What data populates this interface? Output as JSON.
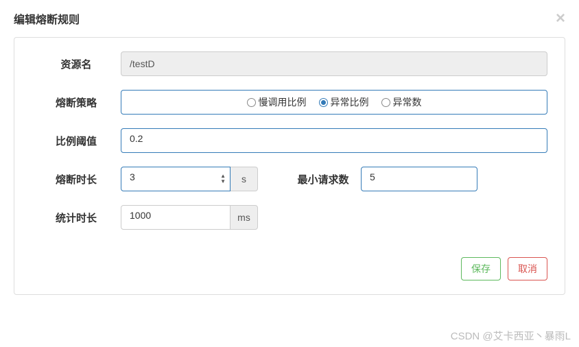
{
  "modal": {
    "title": "编辑熔断规则"
  },
  "form": {
    "resource": {
      "label": "资源名",
      "value": "/testD"
    },
    "strategy": {
      "label": "熔断策略",
      "options": [
        {
          "label": "慢调用比例",
          "checked": false
        },
        {
          "label": "异常比例",
          "checked": true
        },
        {
          "label": "异常数",
          "checked": false
        }
      ]
    },
    "threshold": {
      "label": "比例阈值",
      "value": "0.2"
    },
    "duration": {
      "label": "熔断时长",
      "value": "3",
      "unit": "s"
    },
    "minRequests": {
      "label": "最小请求数",
      "value": "5"
    },
    "statWindow": {
      "label": "统计时长",
      "value": "1000",
      "unit": "ms"
    }
  },
  "footer": {
    "save": "保存",
    "cancel": "取消"
  },
  "watermark": "CSDN @艾卡西亚丶暴雨L"
}
